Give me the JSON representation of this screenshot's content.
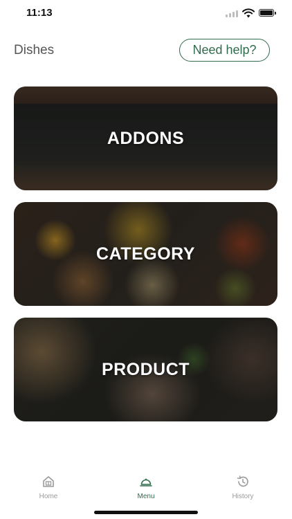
{
  "status_bar": {
    "time": "11:13",
    "icons": [
      "cellular-signal-icon",
      "wifi-icon",
      "battery-icon"
    ]
  },
  "header": {
    "title": "Dishes",
    "help_label": "Need help?"
  },
  "cards": [
    {
      "label": "ADDONS"
    },
    {
      "label": "CATEGORY"
    },
    {
      "label": "PRODUCT"
    }
  ],
  "tab_bar": {
    "items": [
      {
        "label": "Home",
        "icon": "home-icon",
        "active": false
      },
      {
        "label": "Menu",
        "icon": "cloche-icon",
        "active": true
      },
      {
        "label": "History",
        "icon": "history-icon",
        "active": false
      }
    ]
  },
  "colors": {
    "accent": "#2f6b4c",
    "inactive": "#9a9a9a",
    "title": "#555555"
  }
}
